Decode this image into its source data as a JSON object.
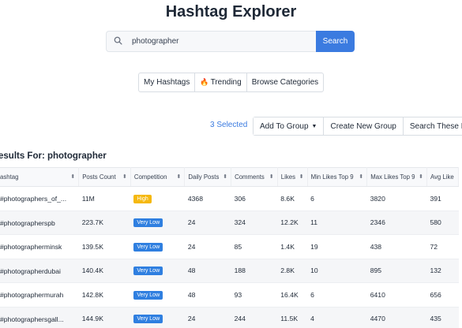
{
  "header": {
    "title": "Hashtag Explorer"
  },
  "search": {
    "value": "photographer",
    "button_label": "Search"
  },
  "tabs": [
    {
      "label": "My Hashtags"
    },
    {
      "label": "Trending"
    },
    {
      "label": "Browse Categories"
    }
  ],
  "toolbar": {
    "selected_text": "3 Selected",
    "add_to_group": "Add To Group",
    "create_group": "Create New Group",
    "search_these": "Search These Ha"
  },
  "results_label": "esults For: photographer",
  "table": {
    "columns": [
      "ashtag",
      "Posts Count",
      "Competition",
      "Daily Posts",
      "Comments",
      "Likes",
      "Min Likes Top 9",
      "Max Likes Top 9",
      "Avg Like"
    ],
    "rows": [
      {
        "tag": "#photographers_of_...",
        "posts": "11M",
        "competition": "High",
        "daily": "4368",
        "comments": "306",
        "likes": "8.6K",
        "min": "6",
        "max": "3820",
        "avg": "391"
      },
      {
        "tag": "#photographerspb",
        "posts": "223.7K",
        "competition": "Very Low",
        "daily": "24",
        "comments": "324",
        "likes": "12.2K",
        "min": "11",
        "max": "2346",
        "avg": "580"
      },
      {
        "tag": "#photographerminsk",
        "posts": "139.5K",
        "competition": "Very Low",
        "daily": "24",
        "comments": "85",
        "likes": "1.4K",
        "min": "19",
        "max": "438",
        "avg": "72"
      },
      {
        "tag": "#photographerdubai",
        "posts": "140.4K",
        "competition": "Very Low",
        "daily": "48",
        "comments": "188",
        "likes": "2.8K",
        "min": "10",
        "max": "895",
        "avg": "132"
      },
      {
        "tag": "#photographermurah",
        "posts": "142.8K",
        "competition": "Very Low",
        "daily": "48",
        "comments": "93",
        "likes": "16.4K",
        "min": "6",
        "max": "6410",
        "avg": "656"
      },
      {
        "tag": "#photographersgall...",
        "posts": "144.9K",
        "competition": "Very Low",
        "daily": "24",
        "comments": "244",
        "likes": "11.5K",
        "min": "4",
        "max": "4470",
        "avg": "435"
      }
    ]
  }
}
